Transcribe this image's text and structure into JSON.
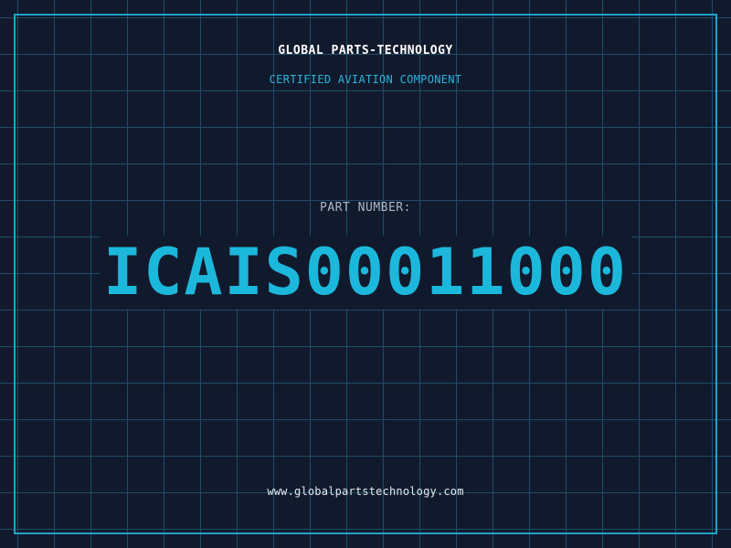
{
  "company_name": "GLOBAL PARTS-TECHNOLOGY",
  "tagline": "CERTIFIED AVIATION COMPONENT",
  "part_number_label": "PART NUMBER:",
  "part_number": "ICAIS00011000",
  "website": "www.globalpartstechnology.com",
  "colors": {
    "background": "#111a2d",
    "grid": "#1d4d66",
    "accent": "#1cb8dc",
    "frame": "#1fa2c8",
    "title_text": "#ffffff",
    "label_text": "#aeb8c6"
  }
}
